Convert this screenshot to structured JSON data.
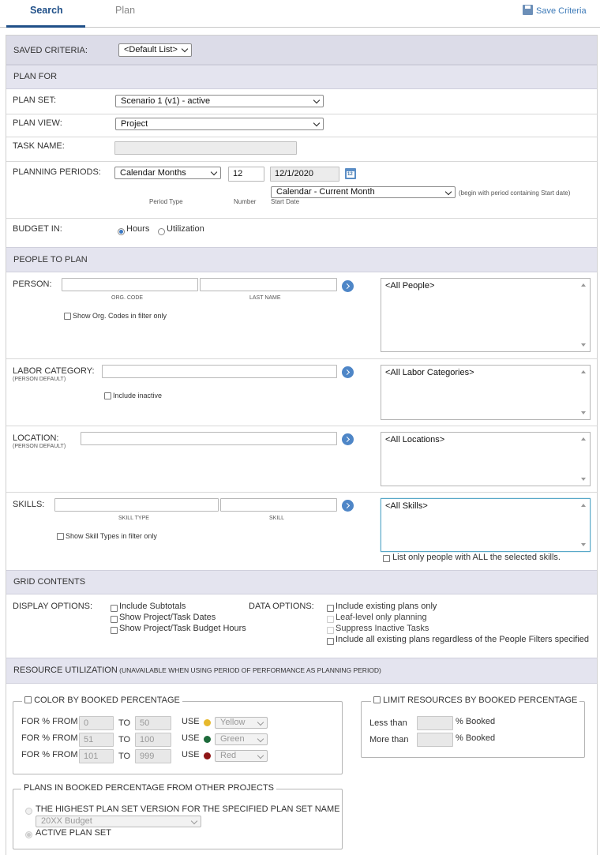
{
  "tabs": {
    "search": "Search",
    "plan": "Plan"
  },
  "save_criteria": "Save Criteria",
  "saved_criteria": {
    "label": "SAVED CRITERIA:",
    "value": "<Default List>"
  },
  "plan_for": {
    "header": "PLAN FOR",
    "plan_set": {
      "label": "PLAN SET:",
      "value": "Scenario 1 (v1) - active"
    },
    "plan_view": {
      "label": "PLAN VIEW:",
      "value": "Project"
    },
    "task_name": {
      "label": "TASK NAME:",
      "value": ""
    },
    "planning_periods": {
      "label": "PLANNING PERIODS:",
      "period_type": "Calendar Months",
      "number": "12",
      "start_date": "12/1/2020",
      "cap_period_type": "Period Type",
      "cap_number": "Number",
      "cap_start_date": "Start Date",
      "start_option": "Calendar - Current Month",
      "start_note": "(begin with period containing Start date)"
    },
    "budget_in": {
      "label": "BUDGET IN:",
      "hours": "Hours",
      "utilization": "Utilization",
      "selected": "hours"
    }
  },
  "people": {
    "header": "PEOPLE TO PLAN",
    "person": {
      "label": "PERSON:",
      "cap_org": "ORG. CODE",
      "cap_last": "LAST NAME",
      "check": "Show Org. Codes in filter only",
      "list": "<All People>"
    },
    "labor": {
      "label": "LABOR CATEGORY:",
      "sub": "(PERSON DEFAULT)",
      "check": "Include inactive",
      "list": "<All Labor Categories>"
    },
    "location": {
      "label": "LOCATION:",
      "sub": "(PERSON DEFAULT)",
      "list": "<All Locations>"
    },
    "skills": {
      "label": "SKILLS:",
      "cap_type": "SKILL TYPE",
      "cap_skill": "SKILL",
      "check": "Show Skill Types in filter only",
      "list": "<All Skills>",
      "all_check": "List only people with ALL the selected skills."
    }
  },
  "grid": {
    "header": "GRID CONTENTS",
    "display_label": "DISPLAY OPTIONS:",
    "display": [
      "Include Subtotals",
      "Show Project/Task Dates",
      "Show Project/Task Budget Hours"
    ],
    "data_label": "DATA OPTIONS:",
    "data": [
      "Include existing plans only",
      "Leaf-level only planning",
      "Suppress Inactive Tasks",
      "Include all existing plans regardless of the People Filters specified"
    ]
  },
  "resource": {
    "header": "RESOURCE UTILIZATION",
    "header_note": " (UNAVAILABLE WHEN USING PERIOD OF PERFORMANCE AS PLANNING PERIOD)",
    "color_by": "COLOR BY BOOKED PERCENTAGE",
    "rows": [
      {
        "for": "FOR % FROM",
        "from": "0",
        "to": "TO",
        "to_val": "50",
        "use": "USE",
        "color": "#e7b92d",
        "color_name": "Yellow"
      },
      {
        "for": "FOR % FROM",
        "from": "51",
        "to": "TO",
        "to_val": "100",
        "use": "USE",
        "color": "#1d6a3a",
        "color_name": "Green"
      },
      {
        "for": "FOR % FROM",
        "from": "101",
        "to": "TO",
        "to_val": "999",
        "use": "USE",
        "color": "#8e1515",
        "color_name": "Red"
      }
    ],
    "limit": "LIMIT RESOURCES BY BOOKED PERCENTAGE",
    "less_than": "Less than",
    "more_than": "More than",
    "booked": "% Booked",
    "plans_in": "PLANS IN BOOKED PERCENTAGE FROM OTHER PROJECTS",
    "highest": "THE HIGHEST PLAN SET VERSION FOR THE SPECIFIED PLAN SET NAME",
    "budget_select": "20XX Budget",
    "active": "ACTIVE PLAN SET"
  }
}
